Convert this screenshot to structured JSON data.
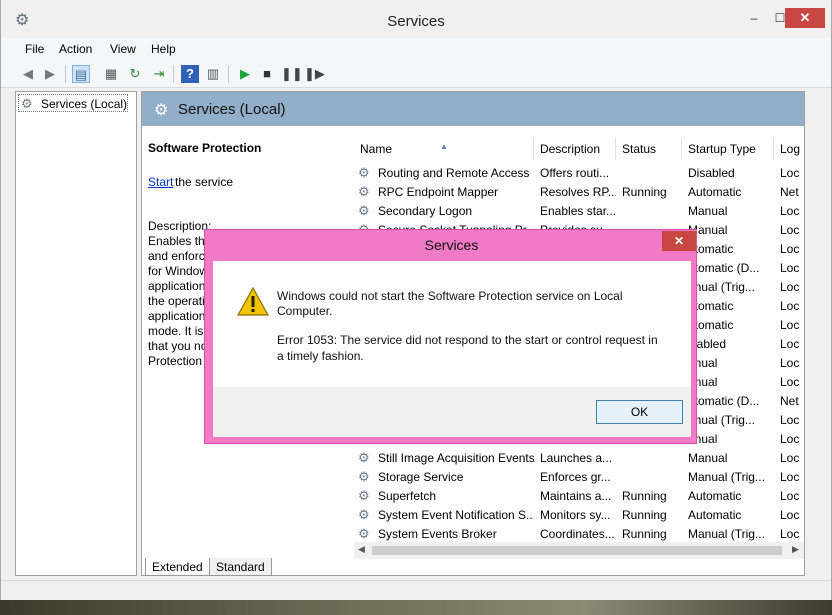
{
  "window": {
    "title": "Services",
    "minimize": "–",
    "maximize": "☐",
    "close": "✕"
  },
  "menu": [
    "File",
    "Action",
    "View",
    "Help"
  ],
  "toolbar": {
    "icons": [
      "back-arrow-icon",
      "forward-arrow-icon",
      "show-hide-console-tree-icon",
      "properties-icon",
      "refresh-icon",
      "export-list-icon",
      "help-icon",
      "action-pane-icon",
      "start-service-icon",
      "stop-service-icon",
      "pause-service-icon",
      "resume-service-icon"
    ]
  },
  "tree": {
    "item": "Services (Local)"
  },
  "pane": {
    "title": "Services (Local)",
    "selected_service": "Software Protection",
    "start_link": "Start",
    "start_rest": "the service",
    "description_label": "Description:",
    "description_lines": [
      "Enables the",
      "and enforc",
      "for Window",
      "application",
      "the operati",
      "application",
      "mode. It is",
      "that you no",
      "Protection"
    ]
  },
  "table": {
    "columns": [
      "Name",
      "Description",
      "Status",
      "Startup Type",
      "Log"
    ],
    "rows": [
      [
        "Routing and Remote Access",
        "Offers routi...",
        "",
        "Disabled",
        "Loc"
      ],
      [
        "RPC Endpoint Mapper",
        "Resolves RP...",
        "Running",
        "Automatic",
        "Net"
      ],
      [
        "Secondary Logon",
        "Enables star...",
        "",
        "Manual",
        "Loc"
      ],
      [
        "Secure Socket Tunneling Pr...",
        "Provides su...",
        "",
        "Manual",
        "Loc"
      ],
      [
        "",
        "",
        "",
        "utomatic",
        "Loc"
      ],
      [
        "",
        "",
        "",
        "utomatic (D...",
        "Loc"
      ],
      [
        "",
        "",
        "",
        "anual (Trig...",
        "Loc"
      ],
      [
        "",
        "",
        "",
        "utomatic",
        "Loc"
      ],
      [
        "",
        "",
        "",
        "utomatic",
        "Loc"
      ],
      [
        "",
        "",
        "",
        "isabled",
        "Loc"
      ],
      [
        "",
        "",
        "",
        "anual",
        "Loc"
      ],
      [
        "",
        "",
        "",
        "anual",
        "Loc"
      ],
      [
        "",
        "",
        "",
        "utomatic (D...",
        "Net"
      ],
      [
        "",
        "",
        "",
        "anual (Trig...",
        "Loc"
      ],
      [
        "",
        "",
        "",
        "anual",
        "Loc"
      ],
      [
        "Still Image Acquisition Events",
        "Launches a...",
        "",
        "Manual",
        "Loc"
      ],
      [
        "Storage Service",
        "Enforces gr...",
        "",
        "Manual (Trig...",
        "Loc"
      ],
      [
        "Superfetch",
        "Maintains a...",
        "Running",
        "Automatic",
        "Loc"
      ],
      [
        "System Event Notification S...",
        "Monitors sy...",
        "Running",
        "Automatic",
        "Loc"
      ],
      [
        "System Events Broker",
        "Coordinates...",
        "Running",
        "Manual (Trig...",
        "Loc"
      ]
    ]
  },
  "tabs": [
    "Extended",
    "Standard"
  ],
  "dialog": {
    "title": "Services",
    "close": "✕",
    "message_lines": [
      "Windows could not start the Software Protection service on Local",
      "Computer.",
      "",
      "Error 1053: The service did not respond to the start or control request in",
      "a timely fashion."
    ],
    "ok": "OK"
  },
  "colors": {
    "pane_header": "#92afc9",
    "dialog_frame": "#f07ac6",
    "close_red": "#c7463f",
    "link": "#0033cc"
  }
}
